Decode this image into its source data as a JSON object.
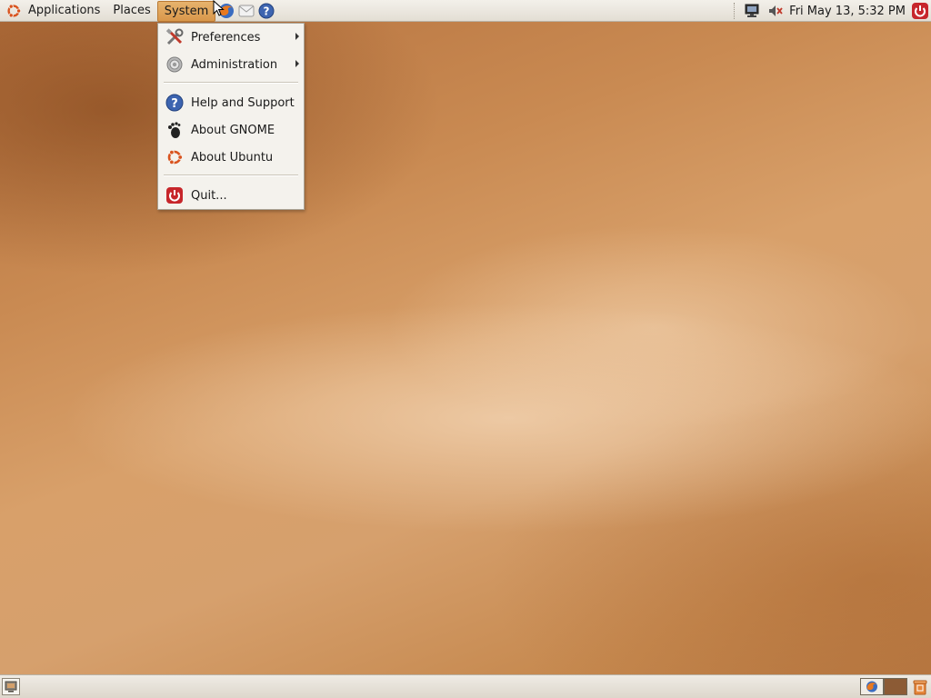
{
  "top_panel": {
    "menus": [
      {
        "label": "Applications"
      },
      {
        "label": "Places"
      },
      {
        "label": "System"
      }
    ],
    "launchers": [
      "firefox-icon",
      "mail-icon",
      "help-icon"
    ],
    "tray": {
      "icons": [
        "network-icon",
        "volume-muted-icon"
      ],
      "clock": "Fri May 13,  5:32 PM",
      "shutdown_icon": "power-icon"
    }
  },
  "system_menu": {
    "items": [
      {
        "label": "Preferences",
        "icon": "preferences-icon",
        "submenu": true
      },
      {
        "label": "Administration",
        "icon": "administration-icon",
        "submenu": true
      },
      {
        "label": "Help and Support",
        "icon": "help-icon",
        "submenu": false
      },
      {
        "label": "About GNOME",
        "icon": "gnome-foot-icon",
        "submenu": false
      },
      {
        "label": "About Ubuntu",
        "icon": "ubuntu-logo-icon",
        "submenu": false
      },
      {
        "label": "Quit...",
        "icon": "quit-icon",
        "submenu": false
      }
    ]
  },
  "bottom_panel": {
    "left_icon": "show-desktop-icon",
    "workspaces": [
      "workspace-1",
      "workspace-2"
    ],
    "right_icon": "trash-icon"
  },
  "colors": {
    "accent": "#d9974b",
    "panel": "#ebe7df",
    "wallpaper": "#c98a52"
  }
}
